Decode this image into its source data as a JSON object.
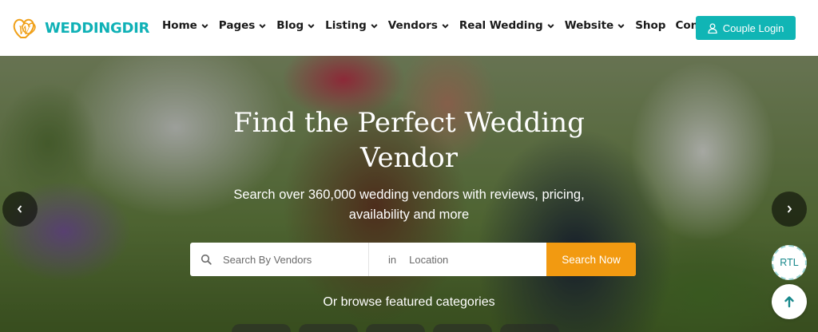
{
  "brand": {
    "name": "WEDDINGDIR",
    "colors": {
      "primary": "#0fb1b6",
      "accent": "#f29a11",
      "logo_orange": "#f0a018"
    }
  },
  "nav": {
    "items": [
      {
        "label": "Home",
        "dropdown": true
      },
      {
        "label": "Pages",
        "dropdown": true
      },
      {
        "label": "Blog",
        "dropdown": true
      },
      {
        "label": "Listing",
        "dropdown": true
      },
      {
        "label": "Vendors",
        "dropdown": true
      },
      {
        "label": "Real Wedding",
        "dropdown": true
      },
      {
        "label": "Website",
        "dropdown": true
      },
      {
        "label": "Shop",
        "dropdown": false
      },
      {
        "label": "Contact Us",
        "dropdown": false
      }
    ],
    "login": {
      "label": "Couple Login",
      "icon": "user-icon"
    }
  },
  "hero": {
    "title_line1": "Find the Perfect Wedding",
    "title_line2": "Vendor",
    "subtitle_line1": "Search over 360,000 wedding vendors with reviews, pricing,",
    "subtitle_line2": "availability and more",
    "search": {
      "vendor_placeholder": "Search By Vendors",
      "location_prefix": "in",
      "location_placeholder": "Location",
      "button_label": "Search Now"
    },
    "browse_text": "Or browse featured categories"
  },
  "widgets": {
    "rtl_label": "RTL",
    "prev_icon": "chevron-left-icon",
    "next_icon": "chevron-right-icon",
    "top_icon": "arrow-up-icon"
  }
}
